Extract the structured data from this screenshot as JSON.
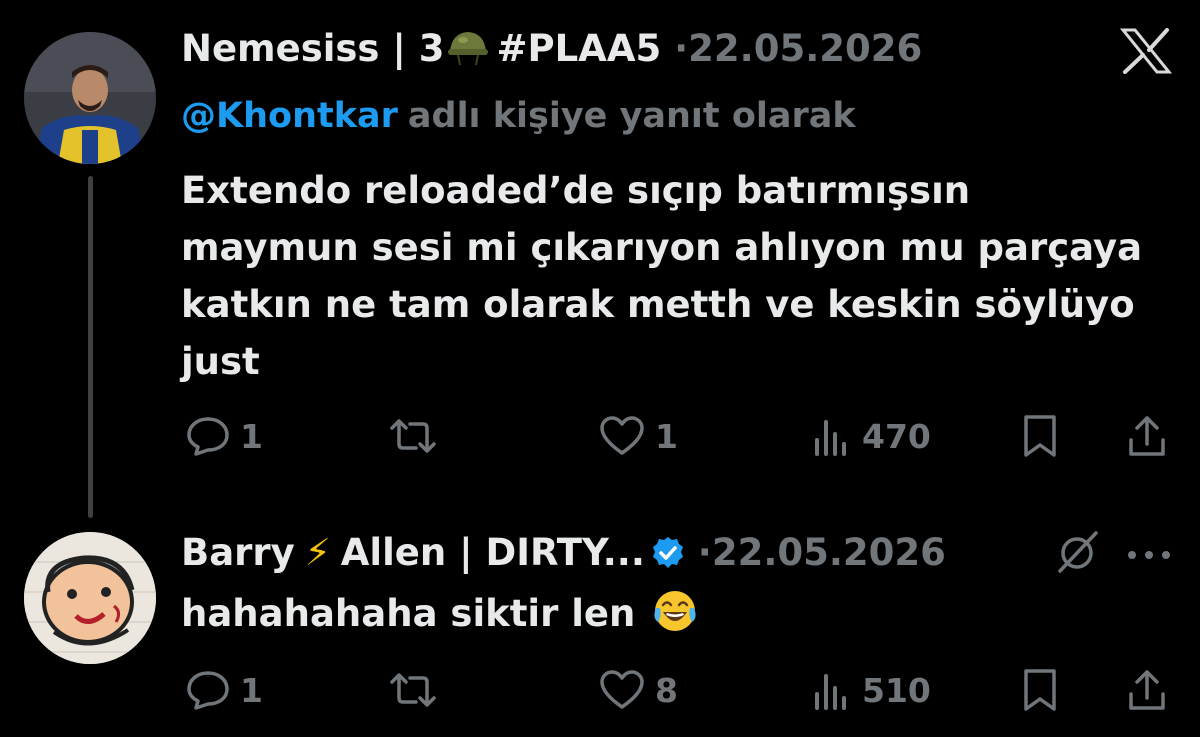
{
  "tweets": [
    {
      "display_name": "Nemesiss | 3",
      "name_suffix": "#PLAA5",
      "separator": "·",
      "date": "22.05.2026",
      "reply_handle": "@Khontkar",
      "reply_suffix": "adlı kişiye yanıt olarak",
      "text": "Extendo reloaded’de sıçıp batırmışsın\nmaymun sesi mi çıkarıyon ahlıyon mu parçaya\nkatkın ne tam olarak metth ve keskin söylüyo\njust",
      "stats": {
        "replies": "1",
        "retweets": "",
        "likes": "1",
        "views": "470"
      }
    },
    {
      "display_name_part1": "Barry",
      "display_name_part2": "Allen | DIRTY...",
      "bolt": "⚡",
      "separator": "·",
      "date": "22.05.2026",
      "more": "···",
      "text": "hahahahaha siktir len",
      "stats": {
        "replies": "1",
        "retweets": "",
        "likes": "8",
        "views": "510"
      }
    }
  ],
  "icons": {
    "platform": "x-logo-icon",
    "helmet": "military-helmet-emoji",
    "verified": "verified-badge-icon",
    "emoji": "face-with-tears-of-joy-emoji",
    "mute": "mute-conversation-icon"
  },
  "colors": {
    "background": "#000000",
    "text": "#e7e9ea",
    "muted": "#71767b",
    "link": "#1d9bf0",
    "verified": "#1d9bf0"
  }
}
